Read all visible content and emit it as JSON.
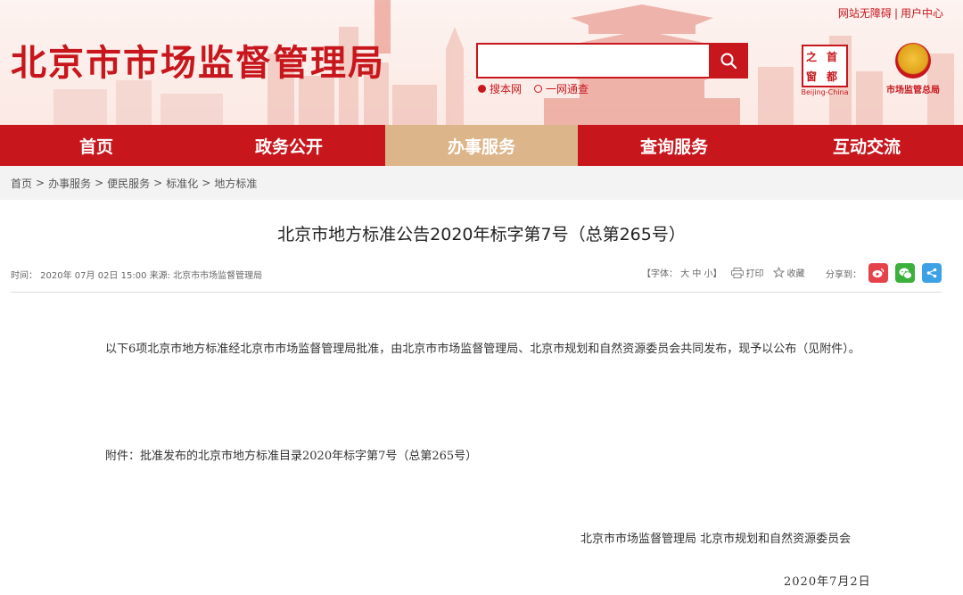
{
  "colors": {
    "brand_red": "#c8161d",
    "nav_active": "#dcb58a",
    "breadcrumb_bg": "#f3f3f3"
  },
  "header": {
    "site_title": "北京市市场监督管理局",
    "top_links": [
      "网站无障碍",
      "用户中心"
    ],
    "top_sep": "|",
    "search": {
      "placeholder": "",
      "button_icon": "search-icon",
      "options": [
        "搜本网",
        "一网通查"
      ]
    },
    "logo_capital": {
      "chars": [
        "之",
        "首",
        "窗",
        "都"
      ],
      "caption": "Beijing-China"
    },
    "logo_samr": {
      "caption": "市场监管总局"
    }
  },
  "nav": {
    "items": [
      {
        "label": "首页",
        "active": false
      },
      {
        "label": "政务公开",
        "active": false
      },
      {
        "label": "办事服务",
        "active": true
      },
      {
        "label": "查询服务",
        "active": false
      },
      {
        "label": "互动交流",
        "active": false
      }
    ]
  },
  "breadcrumb": [
    "首页",
    "办事服务",
    "便民服务",
    "标准化",
    "地方标准"
  ],
  "breadcrumb_sep": ">",
  "article": {
    "title": "北京市地方标准公告2020年标字第7号（总第265号）",
    "meta_left": "时间：  2020年 07月 02日 15:00  来源:    北京市市场监督管理局",
    "font_size_label": "【字体：  大  中  小】",
    "print_label": "打印",
    "favorite_label": "收藏",
    "share_label": "分享到：",
    "share_icons": [
      "weibo-icon",
      "wechat-icon",
      "share-icon"
    ],
    "body": "以下6项北京市地方标准经北京市市场监督管理局批准，由北京市市场监督管理局、北京市规划和自然资源委员会共同发布，现予以公布（见附件）。",
    "attachment": "附件：批准发布的北京市地方标准目录2020年标字第7号（总第265号）",
    "signature": "北京市市场监督管理局  北京市规划和自然资源委员会",
    "date": "2020年7月2日"
  }
}
